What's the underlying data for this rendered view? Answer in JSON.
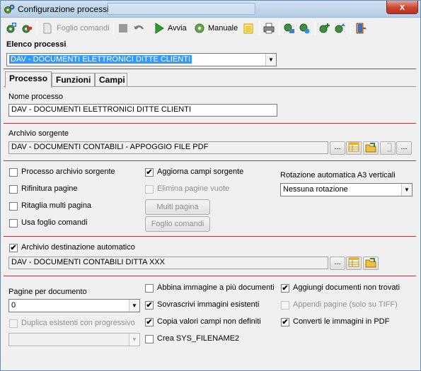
{
  "window": {
    "title": "Configurazione processi",
    "close_label": "x"
  },
  "toolbar": {
    "foglio_comandi_label": "Foglio comandi",
    "avvia_label": "Avvia",
    "manuale_label": "Manuale"
  },
  "elenco_processi": {
    "label": "Elenco processi",
    "selected": "DAV - DOCUMENTI ELETTRONICI DITTE CLIENTI"
  },
  "tabs": [
    {
      "label": "Processo"
    },
    {
      "label": "Funzioni"
    },
    {
      "label": "Campi"
    }
  ],
  "nome_processo": {
    "label": "Nome processo",
    "value": "DAV - DOCUMENTI ELETTRONICI DITTE CLIENTI"
  },
  "archivio_sorgente": {
    "label": "Archivio sorgente",
    "value": "DAV - DOCUMENTI CONTABILI - APPOGGIO FILE PDF",
    "browse_label": "...",
    "more_label": "..."
  },
  "options": {
    "processo_archivio_sorgente": {
      "label": "Processo archivio sorgente",
      "checked": false
    },
    "rifinitura_pagine": {
      "label": "Rifinitura pagine",
      "checked": false
    },
    "ritaglia_multi_pagina": {
      "label": "Ritaglia multi pagina",
      "checked": false
    },
    "usa_foglio_comandi": {
      "label": "Usa foglio comandi",
      "checked": false
    },
    "aggiorna_campi_sorgente": {
      "label": "Aggiorna campi sorgente",
      "checked": true
    },
    "elimina_pagine_vuote": {
      "label": "Elimina pagine vuote",
      "checked": false
    }
  },
  "buttons": {
    "multi_pagina": "Multi pagina",
    "foglio_comandi": "Foglio comandi"
  },
  "rotazione": {
    "label": "Rotazione automatica A3 verticali",
    "selected": "Nessuna rotazione"
  },
  "archivio_destinazione": {
    "checkbox_label": "Archivio destinazione automatico",
    "checked": true,
    "value": "DAV - DOCUMENTI CONTABILI DITTA XXX",
    "browse_label": "..."
  },
  "pagine_per_documento": {
    "label": "Pagine per documento",
    "value": "0"
  },
  "duplica": {
    "label": "Duplica esistenti con progressivo",
    "checked": false,
    "value": ""
  },
  "bottom_options": {
    "abbina": {
      "label": "Abbina immagine a più documenti",
      "checked": false
    },
    "sovrascrivi": {
      "label": "Sovrascrivi immagini esistenti",
      "checked": true
    },
    "copia_valori": {
      "label": "Copia valori campi non definiti",
      "checked": true
    },
    "crea_sys": {
      "label": "Crea SYS_FILENAME2",
      "checked": false
    },
    "aggiungi": {
      "label": "Aggiungi documenti non trovati",
      "checked": true
    },
    "appendi": {
      "label": "Appendi pagine (solo su TIFF)",
      "checked": false
    },
    "converti": {
      "label": "Converti le immagini in PDF",
      "checked": true
    }
  },
  "checkmark": "✔"
}
